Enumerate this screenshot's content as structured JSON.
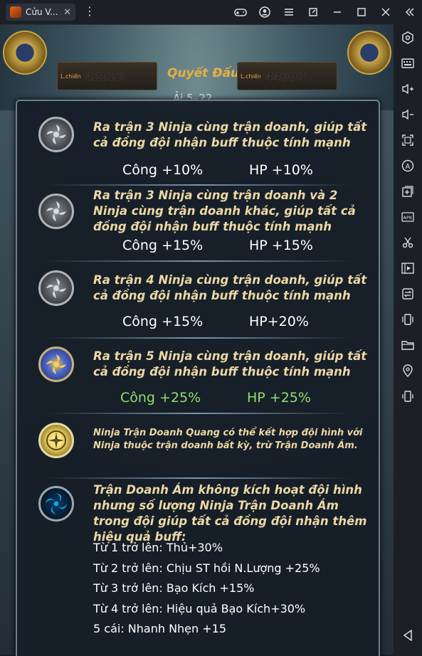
{
  "tab": {
    "title": "Cửu V...",
    "close": "✕"
  },
  "game": {
    "left_score_label": "L.chiến",
    "left_score": "42027",
    "center_title": "Quyết Đấu",
    "right_score_label": "L.chiến",
    "right_score": "44607",
    "round_text": "Ải 5–22"
  },
  "rows": [
    {
      "desc": "Ra trận 3 Ninja cùng trận doanh, giúp tất cả đồng đội nhận buff thuộc tính mạnh",
      "stat1": "Công +10%",
      "stat2": "HP +10%",
      "emblem": "gray-pinwheel-icon"
    },
    {
      "desc": "Ra trận 3 Ninja cùng trận doanh và 2 Ninja cùng trận doanh khác, giúp tất cả đồng đội nhận buff thuộc tính mạnh",
      "stat1": "Công +15%",
      "stat2": "HP +15%",
      "emblem": "gray-pinwheel-icon"
    },
    {
      "desc": "Ra trận 4 Ninja cùng trận doanh, giúp tất cả đồng đội nhận buff thuộc tính mạnh",
      "stat1": "Công +15%",
      "stat2": "HP+20%",
      "emblem": "gray-pinwheel-icon"
    },
    {
      "desc": "Ra trận 5 Ninja cùng trận doanh, giúp tất cả đồng đội nhận buff thuộc tính mạnh",
      "stat1": "Công +25%",
      "stat2": "HP +25%",
      "emblem": "blue-gold-pinwheel-icon"
    }
  ],
  "light": {
    "desc": "Ninja Trận Doanh Quang có thể kết hợp đội hình với Ninja thuộc trận doanh bất kỳ, trừ Trận Doanh Ám.",
    "emblem": "light-faction-icon"
  },
  "dark": {
    "desc": "Trận Doanh Ám không kích hoạt đội hình nhưng số lượng Ninja Trận Doanh Ám trong đội giúp tất cả đồng đội nhận thêm hiệu quả buff:",
    "emblem": "dark-faction-icon",
    "tiers": [
      "Từ 1 trở lên: Thủ+30%",
      "Từ 2 trở lên: Chịu ST hồi N.Lượng +25%",
      "Từ 3 trở lên: Bạo Kích +15%",
      "Từ 4 trở lên: Hiệu quả Bạo Kích+30%",
      "5 cái: Nhanh Nhẹn +15"
    ]
  },
  "colors": {
    "desc_text": "#ecd7a4",
    "stat_text": "#ffffff",
    "active_stat": "#8fe06a",
    "panel_border": "#6e7f90"
  }
}
